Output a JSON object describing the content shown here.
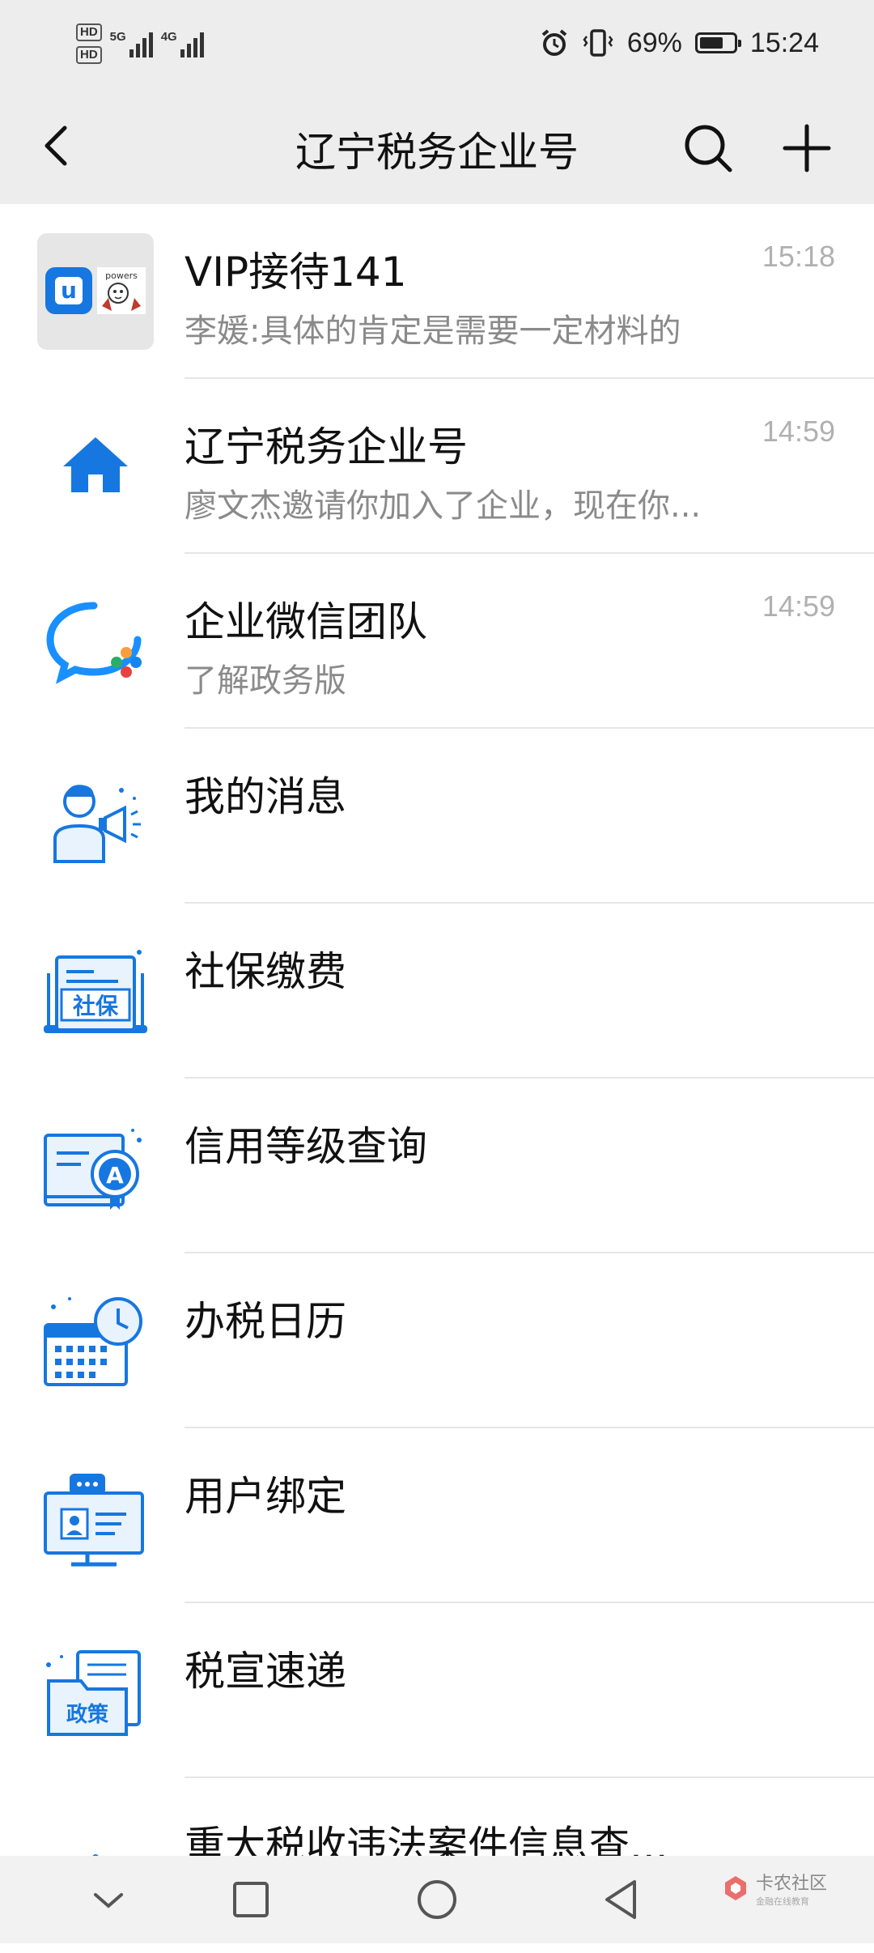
{
  "status_bar": {
    "hd1": "HD",
    "hd2": "HD",
    "net1": "5G",
    "net2": "4G",
    "battery": "69%",
    "battery_level": 0.69,
    "time": "15:24"
  },
  "header": {
    "title": "辽宁税务企业号",
    "back_icon": "back-arrow-icon",
    "search_icon": "search-icon",
    "add_icon": "plus-icon"
  },
  "conversations": [
    {
      "name": "VIP接待141",
      "preview": "李媛:具体的肯定是需要一定材料的",
      "time": "15:18"
    },
    {
      "name": "辽宁税务企业号",
      "preview": "廖文杰邀请你加入了企业，现在你...",
      "time": "14:59"
    },
    {
      "name": "企业微信团队",
      "preview": "了解政务版",
      "time": "14:59"
    },
    {
      "name": "我的消息"
    },
    {
      "name": "社保缴费",
      "icon_text": "社保"
    },
    {
      "name": "信用等级查询",
      "icon_text": "A"
    },
    {
      "name": "办税日历"
    },
    {
      "name": "用户绑定"
    },
    {
      "name": "税宣速递",
      "icon_text": "政策"
    },
    {
      "name": "重大税收违法案件信息查..."
    }
  ],
  "avatar_text": {
    "u": "u",
    "powers": "powers"
  },
  "watermark": {
    "main": "卡农社区",
    "sub": "金融在线教育"
  },
  "colors": {
    "accent": "#1677e0",
    "header_bg": "#ededed",
    "time": "#b0b0b0",
    "sub": "#8a8a8a"
  }
}
